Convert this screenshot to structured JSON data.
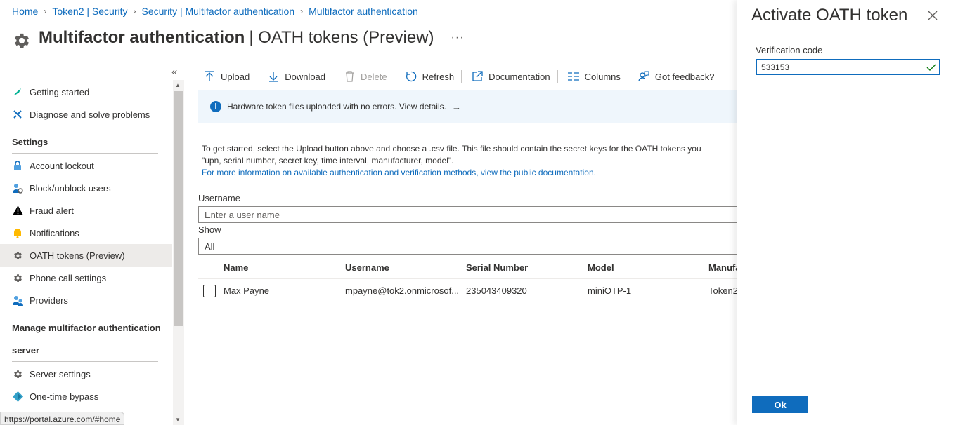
{
  "breadcrumb": [
    "Home",
    "Token2 | Security",
    "Security | Multifactor authentication",
    "Multifactor authentication"
  ],
  "page": {
    "title": "Multifactor authentication",
    "subtitle": "| OATH tokens (Preview)",
    "more": "···"
  },
  "sidebar": {
    "collapse": "«",
    "getting_started": "Getting started",
    "diagnose": "Diagnose and solve problems",
    "settings_header": "Settings",
    "account_lockout": "Account lockout",
    "block_unblock": "Block/unblock users",
    "fraud_alert": "Fraud alert",
    "notifications": "Notifications",
    "oath_tokens": "OATH tokens (Preview)",
    "phone_call": "Phone call settings",
    "providers": "Providers",
    "manage_header_1": "Manage multifactor authentication",
    "manage_header_2": "server",
    "server_settings": "Server settings",
    "one_time_bypass": "One-time bypass"
  },
  "status_url": "https://portal.azure.com/#home",
  "toolbar": {
    "upload": "Upload",
    "download": "Download",
    "delete": "Delete",
    "refresh": "Refresh",
    "documentation": "Documentation",
    "columns": "Columns",
    "feedback": "Got feedback?"
  },
  "banner": {
    "text": "Hardware token files uploaded with no errors. View details.",
    "arrow": "→"
  },
  "description": {
    "line1": "To get started, select the Upload button above and choose a .csv file. This file should contain the secret keys for the OATH tokens you",
    "line2": "\"upn, serial number, secret key, time interval, manufacturer, model\".",
    "link": "For more information on available authentication and verification methods, view the public documentation."
  },
  "form": {
    "username_label": "Username",
    "username_placeholder": "Enter a user name",
    "show_label": "Show",
    "show_value": "All"
  },
  "table": {
    "headers": [
      "Name",
      "Username",
      "Serial Number",
      "Model",
      "Manufa"
    ],
    "rows": [
      [
        "Max Payne",
        "mpayne@tok2.onmicrosof...",
        "235043409320",
        "miniOTP-1",
        "Token2"
      ]
    ]
  },
  "panel": {
    "title": "Activate OATH token",
    "label": "Verification code",
    "value": "533153",
    "ok": "Ok"
  },
  "colors": {
    "accent": "#0f6cbd",
    "banner_bg": "#eff6fc",
    "success": "#107c10"
  }
}
